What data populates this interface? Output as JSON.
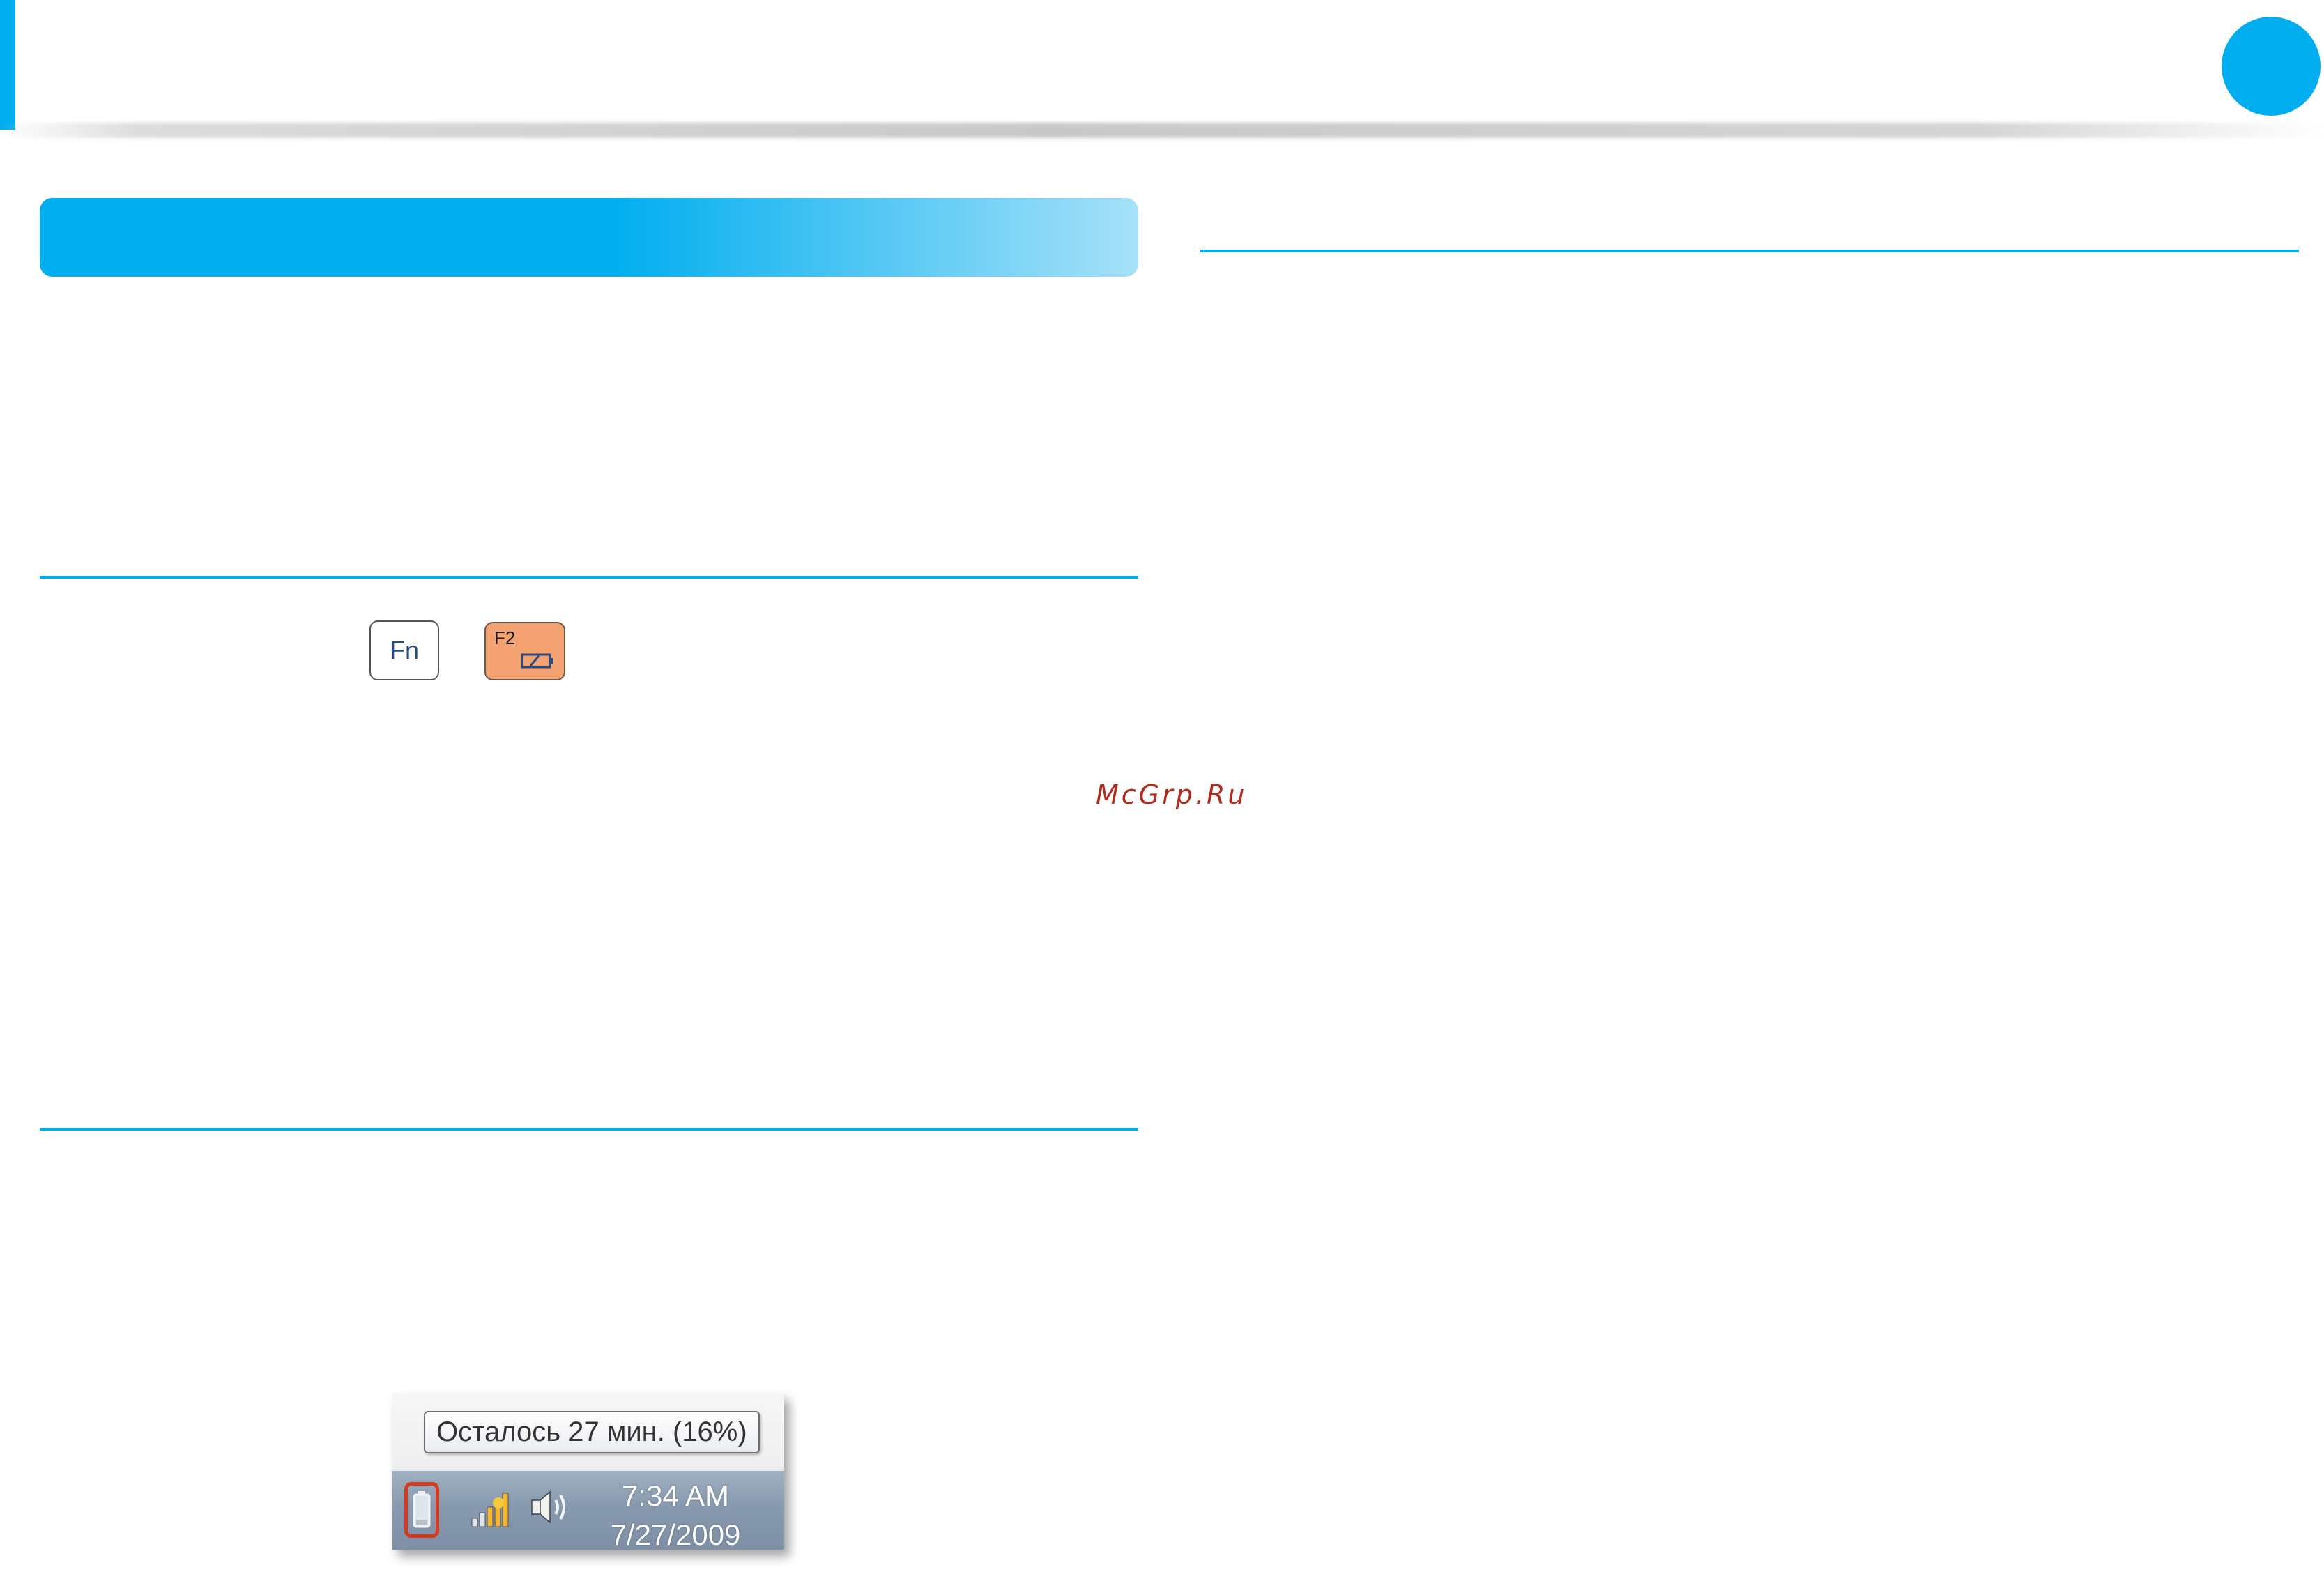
{
  "header": {
    "accent_color": "#00adef"
  },
  "keys": {
    "fn_label": "Fn",
    "f2_label": "F2",
    "f2_icon": "battery-icon"
  },
  "watermark": "McGrp.Ru",
  "taskbar_screenshot": {
    "tooltip": "Осталось 27 мин. (16%)",
    "time": "7:34 AM",
    "date": "7/27/2009",
    "icons": [
      "battery-icon",
      "network-signal-icon",
      "volume-icon"
    ],
    "highlight_color": "#d43a1e"
  }
}
